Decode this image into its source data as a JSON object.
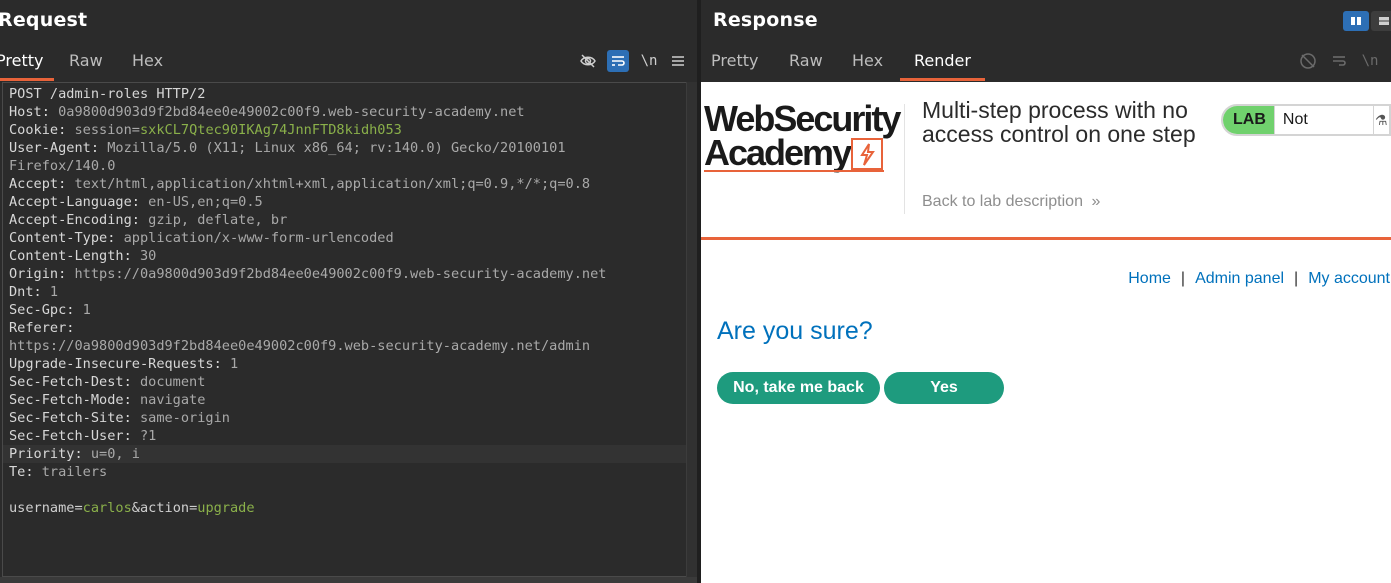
{
  "request": {
    "title": "Request",
    "tabs": [
      {
        "label": "Pretty",
        "active": true
      },
      {
        "label": "Raw",
        "active": false
      },
      {
        "label": "Hex",
        "active": false
      }
    ],
    "toolbar": {
      "icons": [
        "eye-off-icon",
        "wrap-icon",
        "newline-icon",
        "menu-icon"
      ],
      "newline_label": "\\n"
    },
    "lines": [
      {
        "k": "POST /admin-roles HTTP/2",
        "v": ""
      },
      {
        "k": "Host:",
        "v": " 0a9800d903d9f2bd84ee0e49002c00f9.web-security-academy.net"
      },
      {
        "k": "Cookie:",
        "v": " session=",
        "g": "sxkCL7Qtec90IKAg74JnnFTD8kidh053"
      },
      {
        "k": "User-Agent:",
        "v": " Mozilla/5.0 (X11; Linux x86_64; rv:140.0) Gecko/20100101"
      },
      {
        "k": "",
        "v": "Firefox/140.0"
      },
      {
        "k": "Accept:",
        "v": " text/html,application/xhtml+xml,application/xml;q=0.9,*/*;q=0.8"
      },
      {
        "k": "Accept-Language:",
        "v": " en-US,en;q=0.5"
      },
      {
        "k": "Accept-Encoding:",
        "v": " gzip, deflate, br"
      },
      {
        "k": "Content-Type:",
        "v": " application/x-www-form-urlencoded"
      },
      {
        "k": "Content-Length:",
        "v": " 30"
      },
      {
        "k": "Origin:",
        "v": " https://0a9800d903d9f2bd84ee0e49002c00f9.web-security-academy.net"
      },
      {
        "k": "Dnt:",
        "v": " 1"
      },
      {
        "k": "Sec-Gpc:",
        "v": " 1"
      },
      {
        "k": "Referer:",
        "v": ""
      },
      {
        "k": "",
        "v": "https://0a9800d903d9f2bd84ee0e49002c00f9.web-security-academy.net/admin"
      },
      {
        "k": "Upgrade-Insecure-Requests:",
        "v": " 1"
      },
      {
        "k": "Sec-Fetch-Dest:",
        "v": " document"
      },
      {
        "k": "Sec-Fetch-Mode:",
        "v": " navigate"
      },
      {
        "k": "Sec-Fetch-Site:",
        "v": " same-origin"
      },
      {
        "k": "Sec-Fetch-User:",
        "v": " ?1"
      },
      {
        "k": "Priority:",
        "v": " u=0, i",
        "highlight": true
      },
      {
        "k": "Te:",
        "v": " trailers"
      },
      {
        "k": "",
        "v": ""
      },
      {
        "body": true,
        "p1": "username",
        "eq1": "=",
        "val1": "carlos",
        "amp": "&",
        "p2": "action",
        "eq2": "=",
        "val2": "upgrade"
      }
    ]
  },
  "response": {
    "title": "Response",
    "tabs": [
      {
        "label": "Pretty",
        "active": false
      },
      {
        "label": "Raw",
        "active": false
      },
      {
        "label": "Hex",
        "active": false
      },
      {
        "label": "Render",
        "active": true
      }
    ],
    "newline_label": "\\n",
    "page": {
      "logo_line1": "WebSecurity",
      "logo_line2": "Academy",
      "lab_title": "Multi-step process with no access control on one step",
      "back_link": "Back to lab description",
      "back_chevrons": "»",
      "badge_tag": "LAB",
      "badge_state": "Not solved",
      "badge_icon": "⚗",
      "nav": {
        "home": "Home",
        "sep": "|",
        "admin": "Admin panel",
        "account": "My account"
      },
      "heading": "Are you sure?",
      "btn_back": "No, take me back",
      "btn_yes": "Yes"
    },
    "colors": {
      "accent": "#e8633a",
      "link": "#0071bc",
      "button": "#1e9b7e",
      "lab_green": "#70d16d"
    }
  }
}
